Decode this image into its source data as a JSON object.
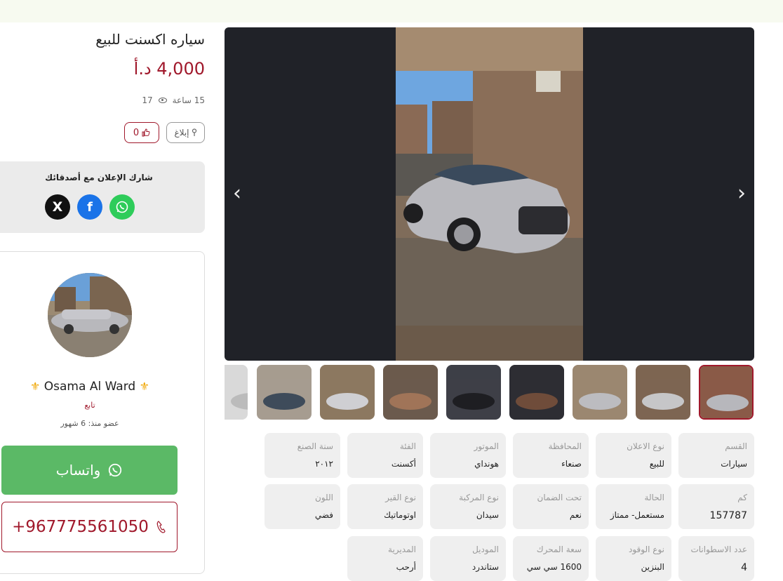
{
  "listing": {
    "title": "سياره اكسنت للبيع",
    "price": "4,000 د.أ",
    "time": "15 ساعة",
    "views": "17",
    "report_label": "إبلاغ",
    "likes": "0"
  },
  "share": {
    "title": "شارك الإعلان مع أصدقائك",
    "x_icon": "X",
    "facebook_icon": "f",
    "whatsapp_icon": "☎"
  },
  "seller": {
    "name": "Osama Al Ward",
    "fleur": "⚜",
    "follow_label": "تابع",
    "member_since": "عضو منذ: 6 شهور",
    "whatsapp_label": "واتساب",
    "phone": "+967775561050"
  },
  "gallery": {
    "prev": "‹",
    "next": "›",
    "thumb_count": 9
  },
  "specs": [
    {
      "label": "القسم",
      "value": "سيارات"
    },
    {
      "label": "نوع الاعلان",
      "value": "للبيع"
    },
    {
      "label": "المحافظة",
      "value": "صنعاء"
    },
    {
      "label": "الموتور",
      "value": "هونداي"
    },
    {
      "label": "الفئة",
      "value": "أكسنت"
    },
    {
      "label": "سنة الصنع",
      "value": "٢٠١٢"
    },
    {
      "label": "كم",
      "value": "157787"
    },
    {
      "label": "الحالة",
      "value": "مستعمل- ممتاز"
    },
    {
      "label": "تحت الضمان",
      "value": "نعم"
    },
    {
      "label": "نوع المركبة",
      "value": "سيدان"
    },
    {
      "label": "نوع القير",
      "value": "اوتوماتيك"
    },
    {
      "label": "اللون",
      "value": "فضي"
    },
    {
      "label": "عدد الاسطوانات",
      "value": "4"
    },
    {
      "label": "نوع الوقود",
      "value": "البنزين"
    },
    {
      "label": "سعة المحرك",
      "value": "1600 سي سي"
    },
    {
      "label": "الموديل",
      "value": "ستاندرد"
    },
    {
      "label": "المديرية",
      "value": "أرحب"
    }
  ],
  "colors": {
    "accent": "#a0182b",
    "whatsapp": "#5bb966"
  }
}
